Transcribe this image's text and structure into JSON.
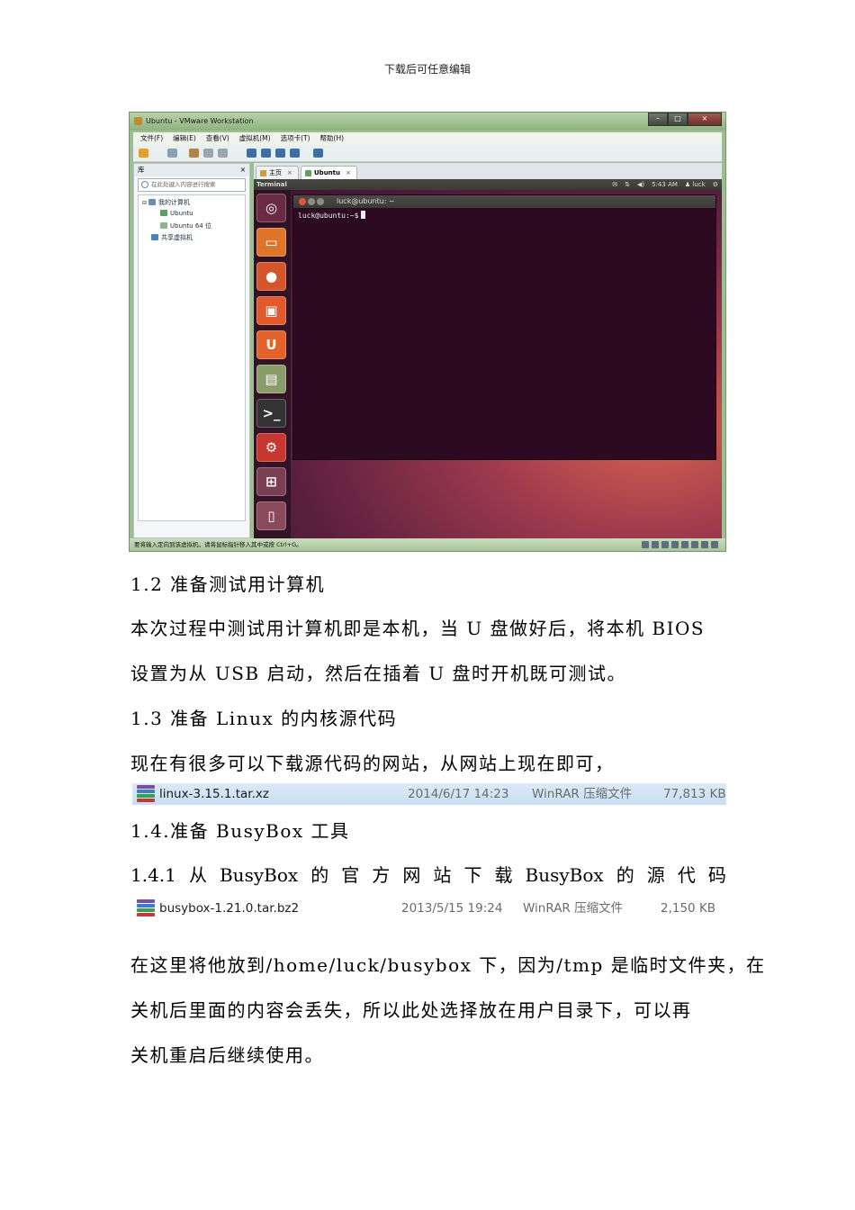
{
  "header_note": "下载后可任意编辑",
  "vmware": {
    "window_title": "Ubuntu - VMware Workstation",
    "menu": [
      "文件(F)",
      "编辑(E)",
      "查看(V)",
      "虚拟机(M)",
      "选项卡(T)",
      "帮助(H)"
    ],
    "library_title": "库",
    "library_close": "×",
    "search_placeholder": "在此处键入内容进行搜索",
    "tree": {
      "my_computer": "我的计算机",
      "vm1": "Ubuntu",
      "vm2": "Ubuntu 64 位",
      "shared": "共享虚拟机"
    },
    "tabs": {
      "home": "主页",
      "ubuntu": "Ubuntu",
      "close": "×"
    },
    "ubuntu_panel": {
      "app": "Terminal",
      "time": "5:43 AM",
      "user": "luck"
    },
    "terminal": {
      "title": "luck@ubuntu: ~",
      "prompt": "luck@ubuntu:~$"
    },
    "status_text": "要将输入定向到该虚拟机，请将鼠标指针移入其中或按 Ctrl+G。"
  },
  "sections": {
    "s12_heading": "1.2 准备测试用计算机",
    "s12_line1": "本次过程中测试用计算机即是本机，当 U 盘做好后，将本机 BIOS",
    "s12_line2": "设置为从 USB 启动，然后在插着 U 盘时开机既可测试。",
    "s13_heading": "1.3 准备 Linux 的内核源代码",
    "s13_text": "现在有很多可以下载源代码的网站，从网站上现在即可，",
    "s14_heading": "1.4.准备 BusyBox 工具",
    "s141_words": [
      "1.4.1",
      "从",
      "BusyBox",
      "的",
      "官",
      "方",
      "网",
      "站",
      "下",
      "载",
      "BusyBox",
      "的",
      "源",
      "代",
      "码"
    ],
    "closing_line1": "在这里将他放到/home/luck/busybox 下，因为/tmp 是临时文件夹，在",
    "closing_line2": "关机后里面的内容会丢失，所以此处选择放在用户目录下，可以再",
    "closing_line3": "关机重启后继续使用。"
  },
  "files": [
    {
      "name": "linux-3.15.1.tar.xz",
      "date": "2014/6/17 14:23",
      "type": "WinRAR 压缩文件",
      "size": "77,813 KB"
    },
    {
      "name": "busybox-1.21.0.tar.bz2",
      "date": "2013/5/15 19:24",
      "type": "WinRAR 压缩文件",
      "size": "2,150 KB"
    }
  ],
  "colors": {
    "ubuntu_bg": "#2c0a22",
    "selection": "#c8def4",
    "vm_frame": "#9bbf8e"
  }
}
